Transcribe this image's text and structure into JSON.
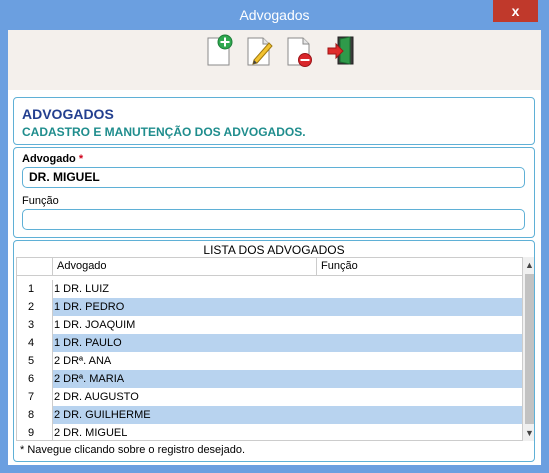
{
  "window": {
    "title": "Advogados",
    "close_label": "x"
  },
  "toolbar": {
    "buttons": [
      {
        "icon": "add-document-icon",
        "action": "novo"
      },
      {
        "icon": "edit-document-icon",
        "action": "editar"
      },
      {
        "icon": "delete-document-icon",
        "action": "excluir"
      },
      {
        "icon": "exit-door-icon",
        "action": "sair"
      }
    ]
  },
  "header": {
    "title": "ADVOGADOS",
    "subtitle": "CADASTRO E MANUTENÇÃO DOS ADVOGADOS."
  },
  "form": {
    "advogado_label": "Advogado",
    "required_mark": "*",
    "advogado_value": "DR. MIGUEL",
    "funcao_label": "Função",
    "funcao_value": ""
  },
  "list": {
    "title": "LISTA DOS ADVOGADOS",
    "columns": [
      "Advogado",
      "Função"
    ],
    "rows": [
      {
        "num": "1",
        "advogado": "1 DR. LUIZ",
        "funcao": ""
      },
      {
        "num": "2",
        "advogado": "1 DR. PEDRO",
        "funcao": ""
      },
      {
        "num": "3",
        "advogado": "1 DR. JOAQUIM",
        "funcao": ""
      },
      {
        "num": "4",
        "advogado": "1 DR. PAULO",
        "funcao": ""
      },
      {
        "num": "5",
        "advogado": "2 DRª. ANA",
        "funcao": ""
      },
      {
        "num": "6",
        "advogado": "2 DRª. MARIA",
        "funcao": ""
      },
      {
        "num": "7",
        "advogado": "2 DR. AUGUSTO",
        "funcao": ""
      },
      {
        "num": "8",
        "advogado": "2 DR. GUILHERME",
        "funcao": ""
      },
      {
        "num": "9",
        "advogado": "2 DR. MIGUEL",
        "funcao": ""
      }
    ],
    "hint": "* Navegue clicando sobre o registro desejado."
  },
  "colors": {
    "titlebar": "#6b9fe0",
    "close": "#c0392b",
    "row_alt": "#b8d3ef",
    "heading": "#233f8f",
    "subheading": "#1f8d8d",
    "border": "#5fb0d6"
  }
}
